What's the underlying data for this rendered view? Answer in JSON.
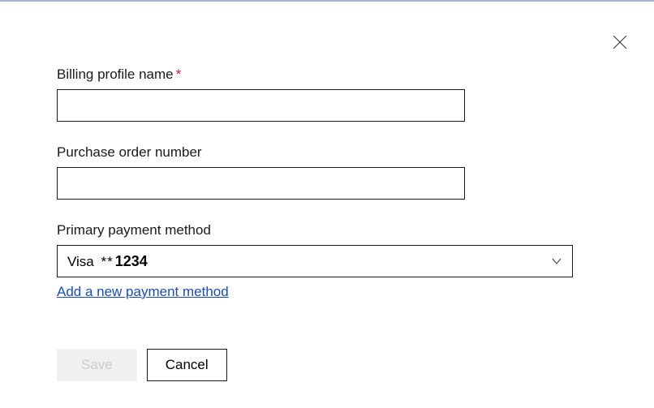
{
  "close_label": "Close",
  "fields": {
    "billing_profile": {
      "label": "Billing profile name",
      "required_marker": "*",
      "value": ""
    },
    "purchase_order": {
      "label": "Purchase order number",
      "value": ""
    },
    "payment_method": {
      "label": "Primary payment method",
      "brand": "Visa",
      "mask": "**",
      "last4": "1234",
      "add_link": "Add a new payment method"
    }
  },
  "buttons": {
    "save": "Save",
    "cancel": "Cancel"
  }
}
